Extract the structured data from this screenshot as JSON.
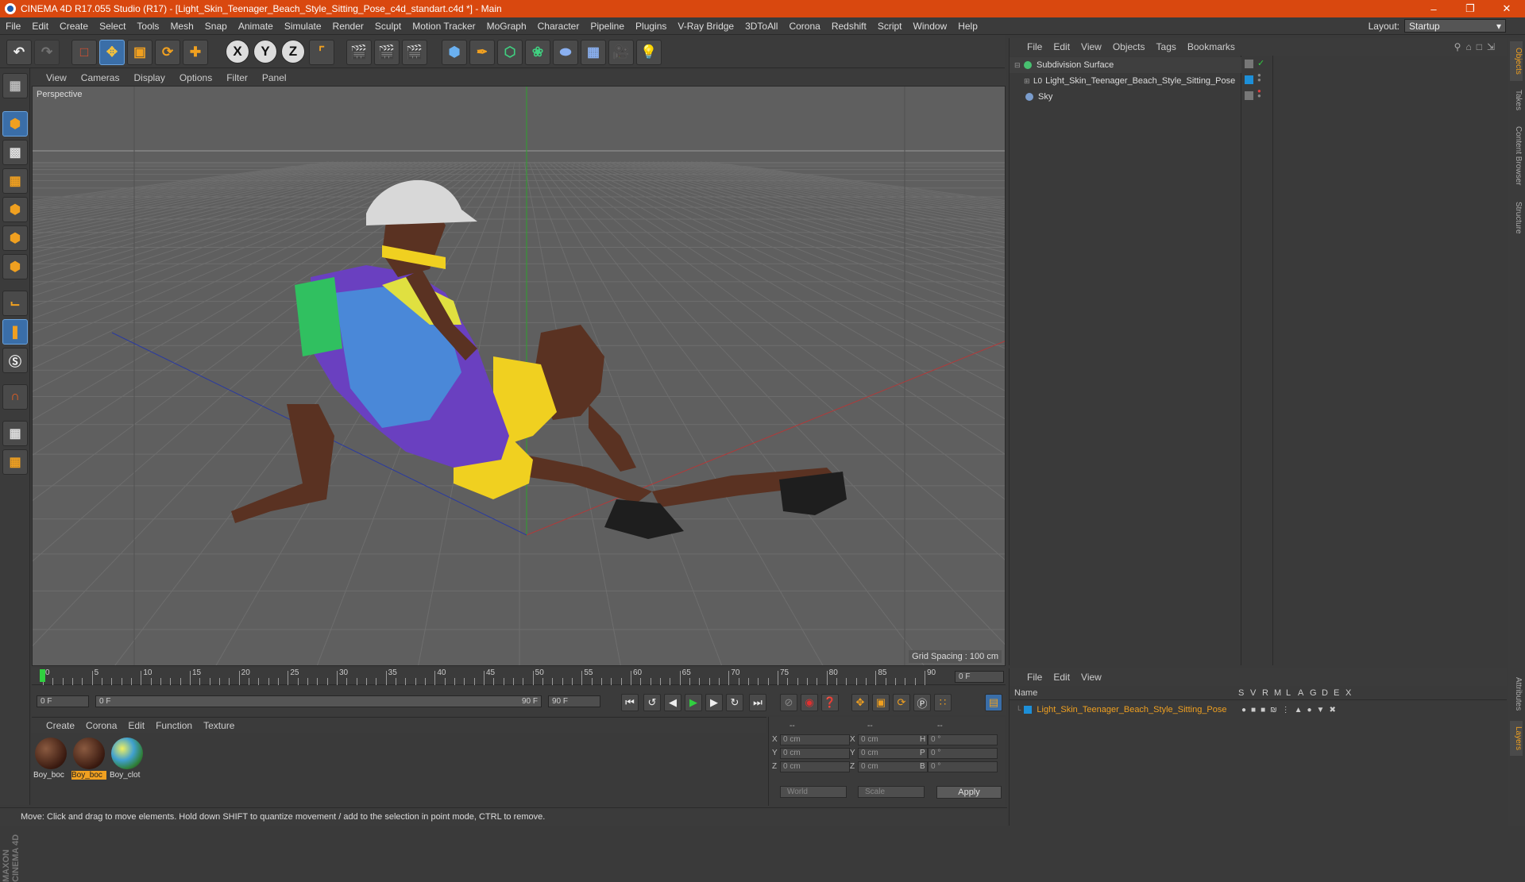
{
  "window": {
    "title": "CINEMA 4D R17.055 Studio (R17) - [Light_Skin_Teenager_Beach_Style_Sitting_Pose_c4d_standart.c4d *] - Main"
  },
  "menu": [
    "File",
    "Edit",
    "Create",
    "Select",
    "Tools",
    "Mesh",
    "Snap",
    "Animate",
    "Simulate",
    "Render",
    "Sculpt",
    "Motion Tracker",
    "MoGraph",
    "Character",
    "Pipeline",
    "Plugins",
    "V-Ray Bridge",
    "3DToAll",
    "Corona",
    "Redshift",
    "Script",
    "Window",
    "Help"
  ],
  "layout": {
    "label": "Layout:",
    "value": "Startup"
  },
  "toolbar": {
    "x_label": "X",
    "y_label": "Y",
    "z_label": "Z"
  },
  "viewport": {
    "menu": [
      "View",
      "Cameras",
      "Display",
      "Options",
      "Filter",
      "Panel"
    ],
    "label": "Perspective",
    "grid_spacing": "Grid Spacing : 100 cm"
  },
  "timeline": {
    "ticks": [
      "0",
      "5",
      "10",
      "15",
      "20",
      "25",
      "30",
      "35",
      "40",
      "45",
      "50",
      "55",
      "60",
      "65",
      "70",
      "75",
      "80",
      "85",
      "90"
    ],
    "end_frame": "0 F"
  },
  "frames": {
    "start": "0 F",
    "range_start": "0 F",
    "range_end": "90 F",
    "end": "90 F"
  },
  "materials": {
    "menu": [
      "Create",
      "Corona",
      "Edit",
      "Function",
      "Texture"
    ],
    "items": [
      {
        "label": "Boy_boc",
        "selected": false
      },
      {
        "label": "Boy_boc",
        "selected": true
      },
      {
        "label": "Boy_clot",
        "selected": false
      }
    ]
  },
  "coords": {
    "headers": [
      "--",
      "--",
      "--"
    ],
    "rows": [
      {
        "a": "X",
        "av": "0 cm",
        "b": "X",
        "bv": "0 cm",
        "c": "H",
        "cv": "0 °"
      },
      {
        "a": "Y",
        "av": "0 cm",
        "b": "Y",
        "bv": "0 cm",
        "c": "P",
        "cv": "0 °"
      },
      {
        "a": "Z",
        "av": "0 cm",
        "b": "Z",
        "bv": "0 cm",
        "c": "B",
        "cv": "0 °"
      }
    ],
    "world": "World",
    "scale": "Scale",
    "apply": "Apply"
  },
  "status": "Move: Click and drag to move elements. Hold down SHIFT to quantize movement / add to the selection in point mode, CTRL to remove.",
  "objects": {
    "menu": [
      "File",
      "Edit",
      "View",
      "Objects",
      "Tags",
      "Bookmarks"
    ],
    "items": [
      {
        "name": "Subdivision Surface",
        "color": "#48c070"
      },
      {
        "name": "Light_Skin_Teenager_Beach_Style_Sitting_Pose",
        "color": "#cfcfcf"
      },
      {
        "name": "Sky",
        "color": "#7a9ccc"
      }
    ]
  },
  "layers": {
    "menu": [
      "File",
      "Edit",
      "View"
    ],
    "name_header": "Name",
    "flags": [
      "S",
      "V",
      "R",
      "M",
      "L",
      "A",
      "G",
      "D",
      "E",
      "X"
    ],
    "item": "Light_Skin_Teenager_Beach_Style_Sitting_Pose"
  },
  "right_tabs": [
    "Objects",
    "Takes",
    "Content Browser",
    "Structure",
    "Attributes",
    "Layers"
  ],
  "colors": {
    "accent": "#d9480f",
    "selection": "#3a6ea8",
    "orange_text": "#f0a020"
  }
}
